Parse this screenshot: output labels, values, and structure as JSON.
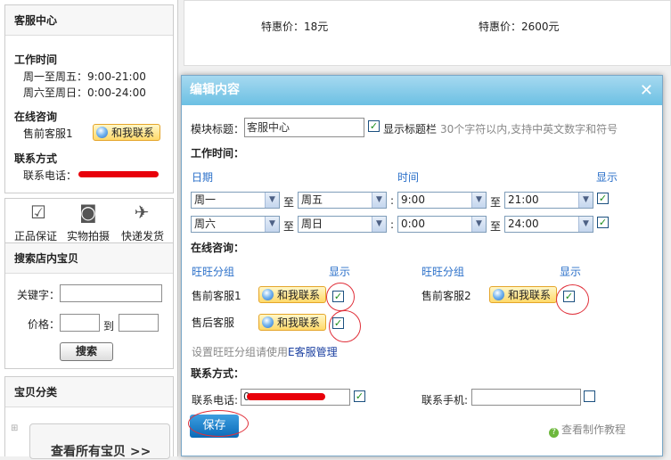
{
  "sidebar": {
    "service": {
      "title": "客服中心",
      "work_time_title": "工作时间",
      "weekday_time": "周一至周五：9:00-21:00",
      "weekend_time": "周六至周日：0:00-24:00",
      "online_title": "在线咨询",
      "presale_label": "售前客服1",
      "contact_button": "和我联系",
      "contact_title": "联系方式",
      "phone_label": "联系电话："
    },
    "features": [
      {
        "icon": "check-icon",
        "label": "正品保证"
      },
      {
        "icon": "camera-icon",
        "label": "实物拍摄"
      },
      {
        "icon": "airplane-icon",
        "label": "快递发货"
      }
    ],
    "search": {
      "title": "搜索店内宝贝",
      "keyword_label": "关键字：",
      "price_label": "价格：",
      "to_label": "到",
      "button": "搜索"
    },
    "category": {
      "title": "宝贝分类",
      "view_all": "查看所有宝贝 >>"
    }
  },
  "products": {
    "price1": "特惠价：18元",
    "price2": "特惠价：2600元"
  },
  "modal": {
    "title": "编辑内容",
    "close": "✕",
    "module_title_label": "模块标题：",
    "module_title_value": "客服中心",
    "show_title_bar": "显示标题栏",
    "title_hint": "30个字符以内,支持中英文数字和符号",
    "work_time_heading": "工作时间：",
    "col_date": "日期",
    "col_time": "时间",
    "col_show": "显示",
    "to": "至",
    "colon": ":",
    "rows": [
      {
        "day_from": "周一",
        "day_to": "周五",
        "time_from": "9:00",
        "time_to": "21:00",
        "show": true
      },
      {
        "day_from": "周六",
        "day_to": "周日",
        "time_from": "0:00",
        "time_to": "24:00",
        "show": true
      }
    ],
    "online_heading": "在线咨询：",
    "ww_group": "旺旺分组",
    "show": "显示",
    "groups": [
      {
        "name": "售前客服1",
        "button": "和我联系",
        "show": true
      },
      {
        "name": "售前客服2",
        "button": "和我联系",
        "show": true
      },
      {
        "name": "售后客服",
        "button": "和我联系",
        "show": true
      }
    ],
    "manage_hint": "设置旺旺分组请使用",
    "manage_link": "E客服管理",
    "contact_heading": "联系方式：",
    "phone_label": "联系电话:",
    "phone_prefix": "0",
    "mobile_label": "联系手机:",
    "phone_show": true,
    "mobile_show": false,
    "save": "保存",
    "tutorial": "查看制作教程"
  }
}
